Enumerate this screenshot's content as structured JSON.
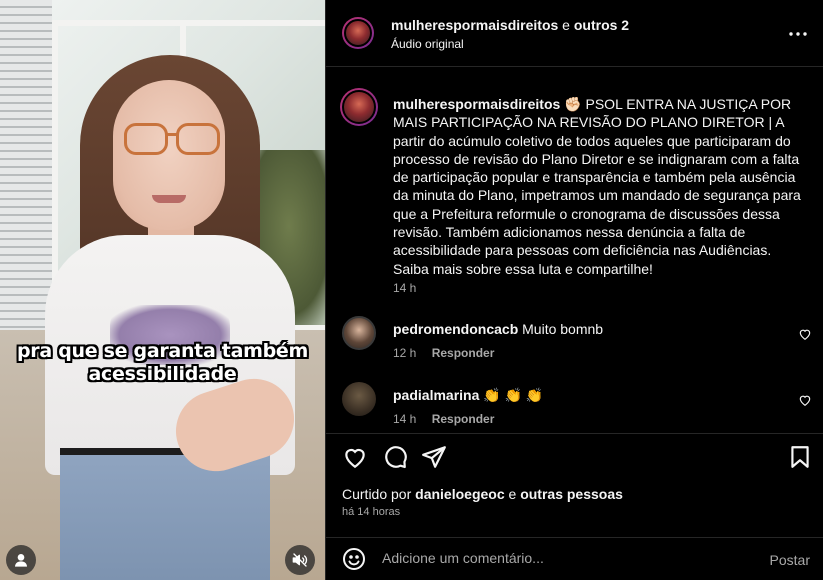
{
  "video": {
    "caption_line1": "pra que se garanta também",
    "caption_line2": "acessibilidade"
  },
  "header": {
    "username": "mulherespormaisdireitos",
    "connector": "e",
    "others": "outros 2",
    "audio": "Áudio original"
  },
  "post_caption": {
    "username": "mulherespormaisdireitos",
    "emoji": "✊🏻",
    "text": "PSOL ENTRA NA JUSTIÇA POR MAIS PARTICIPAÇÃO NA REVISÃO DO PLANO DIRETOR | A partir do acúmulo coletivo de todos aqueles que participaram do processo de revisão do Plano Diretor e se indignaram com a falta de participação popular e transparência e também pela ausência da minuta do Plano, impetramos um mandado de segurança para que a Prefeitura reformule o cronograma de discussões dessa revisão. Também adicionamos nessa denúncia a falta de acessibilidade para pessoas com deficiência nas Audiências. Saiba mais sobre essa luta e compartilhe!",
    "time": "14 h"
  },
  "comments": [
    {
      "username": "pedromendoncacb",
      "text": "Muito bomnb",
      "time": "12 h",
      "reply": "Responder"
    },
    {
      "username": "padialmarina",
      "text": "👏 👏 👏",
      "time": "14 h",
      "reply": "Responder"
    }
  ],
  "likes": {
    "prefix": "Curtido por",
    "user": "danieloegeoc",
    "connector": "e",
    "others": "outras pessoas",
    "time": "há 14 horas"
  },
  "add_comment": {
    "placeholder": "Adicione um comentário...",
    "post_label": "Postar"
  },
  "colors": {
    "background": "#000000",
    "text": "#f5f5f5",
    "secondary": "#a8a8a8",
    "divider": "#262626"
  }
}
